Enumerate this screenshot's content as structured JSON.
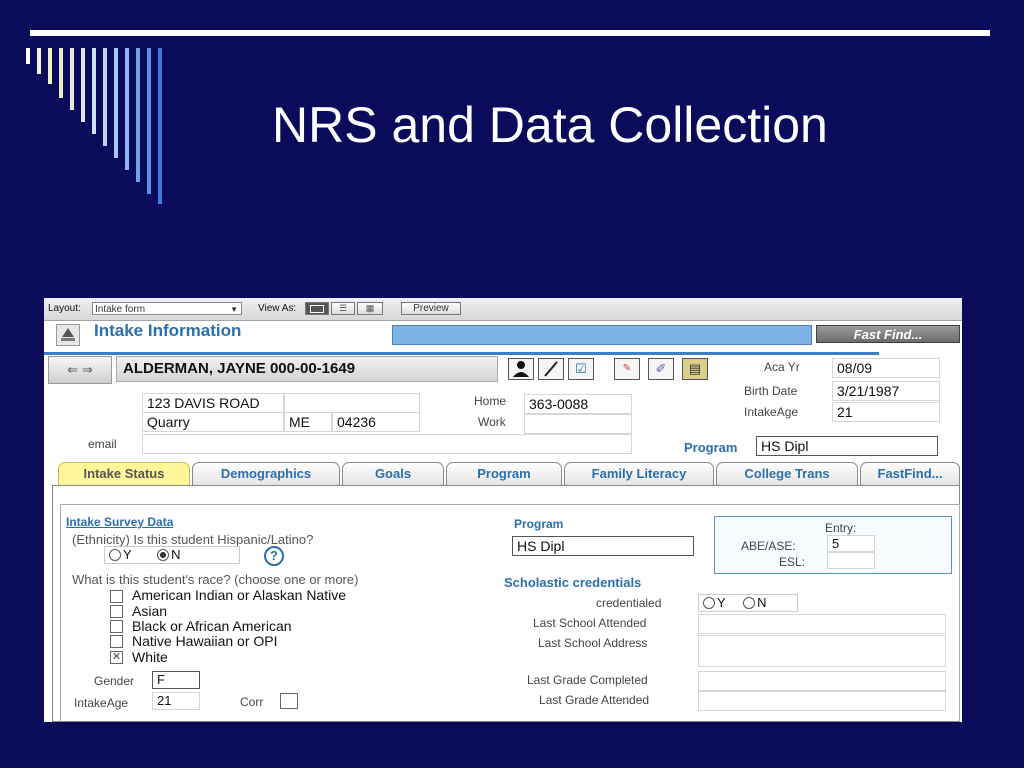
{
  "slide": {
    "title": "NRS and Data Collection"
  },
  "toolbar": {
    "layout_label": "Layout:",
    "layout_value": "Intake form",
    "view_as_label": "View As:",
    "preview_label": "Preview"
  },
  "header": {
    "title": "Intake Information",
    "fast_find": "Fast Find..."
  },
  "student": {
    "name": "ALDERMAN, JAYNE 000-00-1649",
    "address": "123 DAVIS ROAD",
    "city": "Quarry",
    "state": "ME",
    "zip": "04236",
    "home_label": "Home",
    "home_phone": "363-0088",
    "work_label": "Work",
    "work_phone": "",
    "email_label": "email",
    "email": "",
    "aca_yr_label": "Aca Yr",
    "aca_yr": "08/09",
    "birth_date_label": "Birth Date",
    "birth_date": "3/21/1987",
    "intake_age_label": "IntakeAge",
    "intake_age": "21",
    "program_label": "Program",
    "program": "HS Dipl"
  },
  "tabs": [
    {
      "label": "Intake Status"
    },
    {
      "label": "Demographics"
    },
    {
      "label": "Goals"
    },
    {
      "label": "Program"
    },
    {
      "label": "Family Literacy"
    },
    {
      "label": "College Trans"
    },
    {
      "label": "FastFind..."
    }
  ],
  "intake": {
    "section_title": "Intake Survey Data",
    "ethnicity_question": "(Ethnicity) Is this student Hispanic/Latino?",
    "yes": "Y",
    "no": "N",
    "race_question": "What is this student's race? (choose one or more)",
    "races": [
      {
        "label": "American Indian or Alaskan Native",
        "checked": false
      },
      {
        "label": "Asian",
        "checked": false
      },
      {
        "label": "Black or African American",
        "checked": false
      },
      {
        "label": "Native Hawaiian or OPI",
        "checked": false
      },
      {
        "label": "White",
        "checked": true
      }
    ],
    "gender_label": "Gender",
    "gender": "F",
    "intake_age_label": "IntakeAge",
    "intake_age": "21",
    "corr_label": "Corr"
  },
  "program_section": {
    "program_label": "Program",
    "program": "HS Dipl",
    "entry_label": "Entry:",
    "abe_ase_label": "ABE/ASE:",
    "abe_ase": "5",
    "esl_label": "ESL:",
    "esl": "",
    "credentials_title": "Scholastic credentials",
    "credentialed_label": "credentialed",
    "yes": "Y",
    "no": "N",
    "last_school_attended_label": "Last School Attended",
    "last_school_address_label": "Last School Address",
    "last_grade_completed_label": "Last Grade Completed",
    "last_grade_attended_label": "Last Grade Attended"
  },
  "colors": {
    "slide_bg": "#0b0b5c",
    "accent_blue": "#2c6fae",
    "active_tab": "#fff799"
  }
}
